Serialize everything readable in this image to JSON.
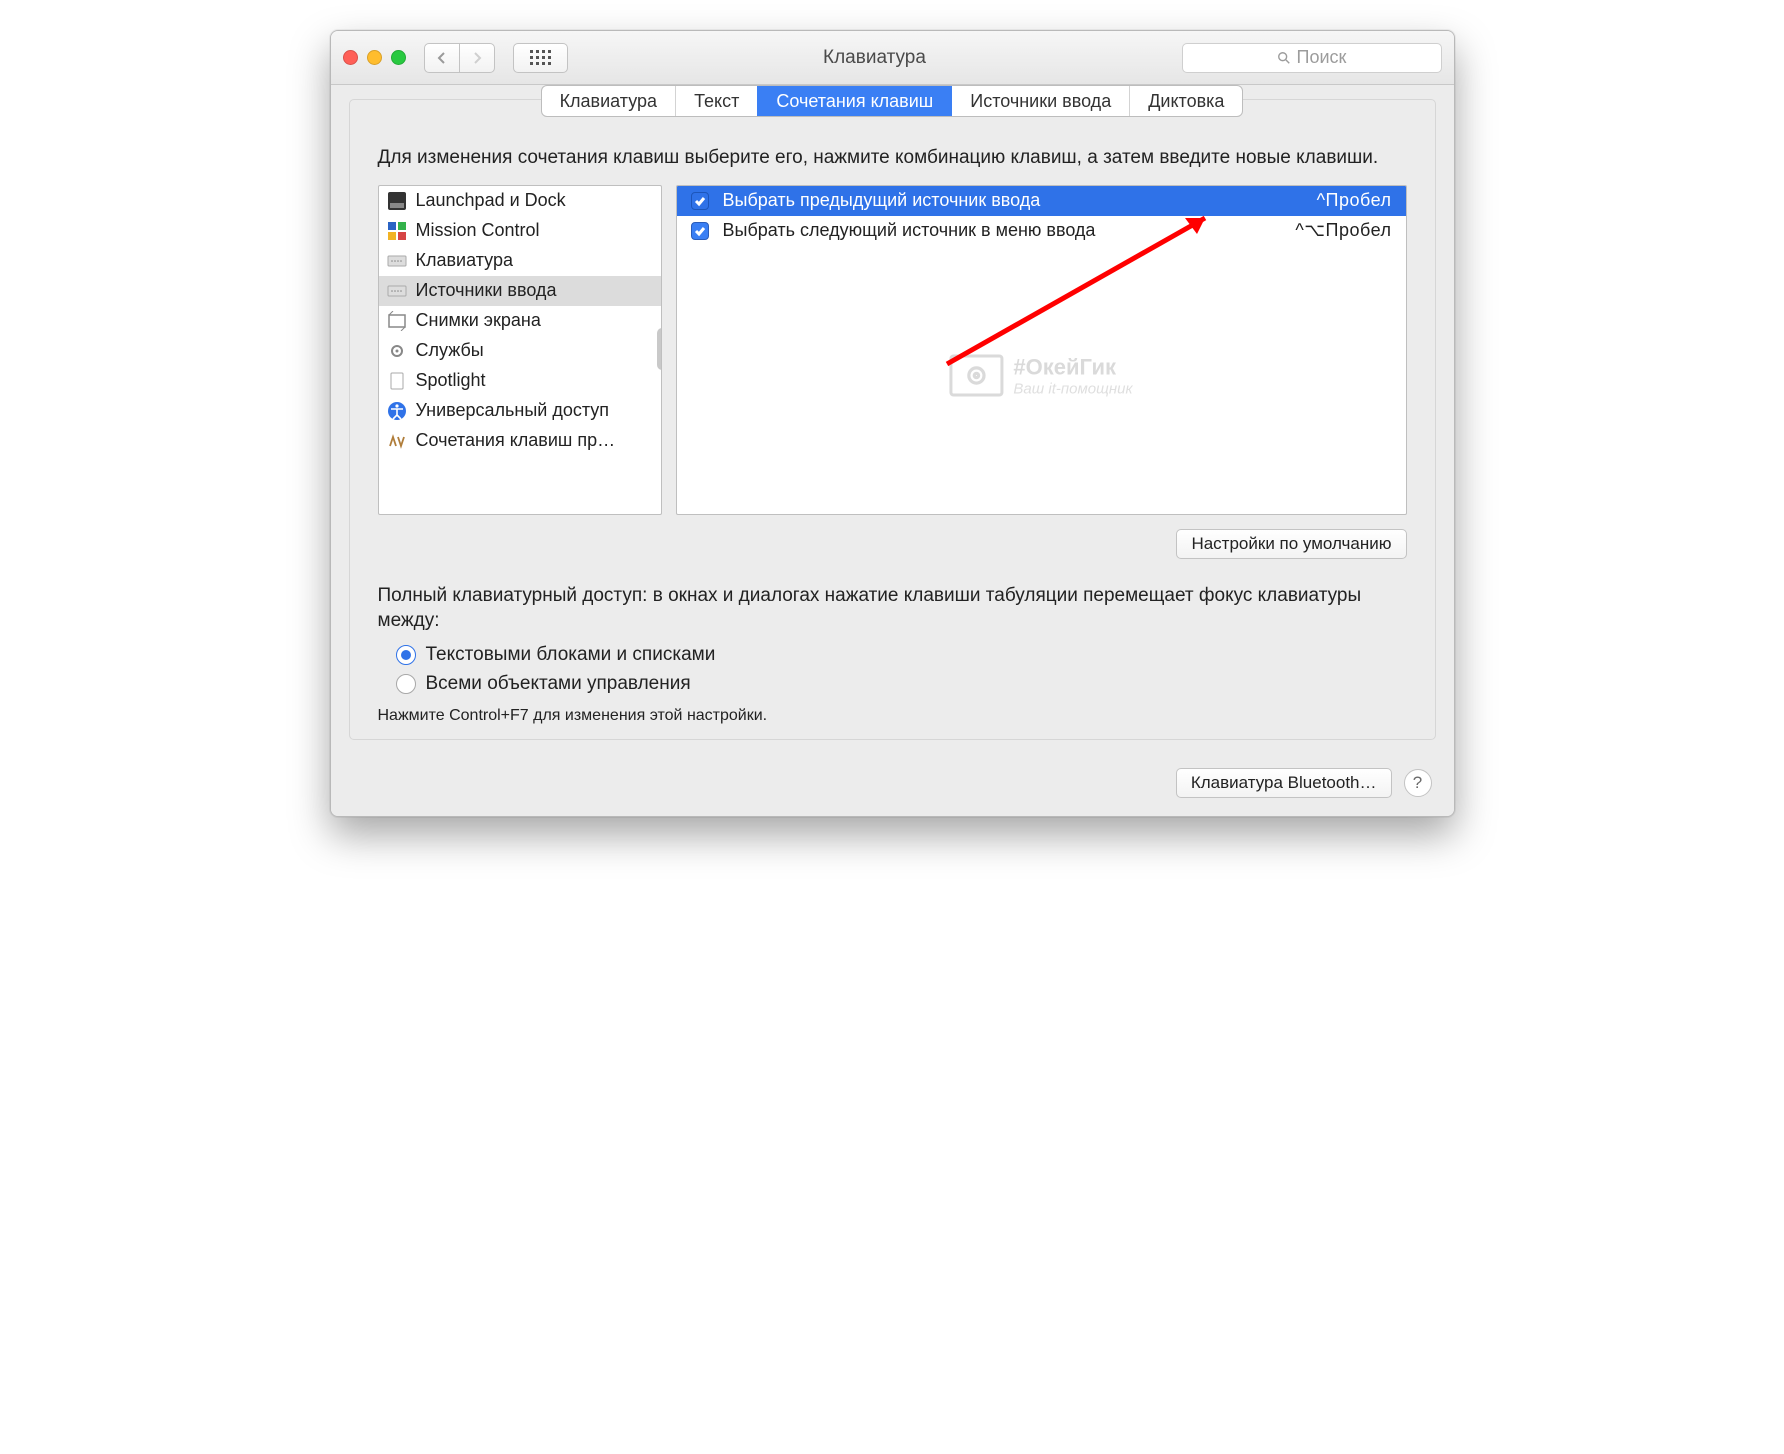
{
  "window": {
    "title": "Клавиатура",
    "search_placeholder": "Поиск"
  },
  "tabs": [
    {
      "label": "Клавиатура",
      "active": false
    },
    {
      "label": "Текст",
      "active": false
    },
    {
      "label": "Сочетания клавиш",
      "active": true
    },
    {
      "label": "Источники ввода",
      "active": false
    },
    {
      "label": "Диктовка",
      "active": false
    }
  ],
  "instruction": "Для изменения сочетания клавиш выберите его, нажмите комбинацию клавиш, а затем введите новые клавиши.",
  "categories": [
    {
      "label": "Launchpad и Dock",
      "icon": "launchpad"
    },
    {
      "label": "Mission Control",
      "icon": "mission"
    },
    {
      "label": "Клавиатура",
      "icon": "keyboard"
    },
    {
      "label": "Источники ввода",
      "icon": "keyboard",
      "selected": true
    },
    {
      "label": "Снимки экрана",
      "icon": "screenshot"
    },
    {
      "label": "Службы",
      "icon": "gear"
    },
    {
      "label": "Spotlight",
      "icon": "doc"
    },
    {
      "label": "Универсальный доступ",
      "icon": "accessibility"
    },
    {
      "label": "Сочетания клавиш пр…",
      "icon": "apps"
    }
  ],
  "shortcuts": [
    {
      "checked": true,
      "label": "Выбрать предыдущий источник ввода",
      "key": "^Пробел",
      "selected": true
    },
    {
      "checked": true,
      "label": "Выбрать следующий источник в меню ввода",
      "key": "^⌥Пробел",
      "selected": false
    }
  ],
  "defaults_button": "Настройки по умолчанию",
  "fullaccess": {
    "text": "Полный клавиатурный доступ: в окнах и диалогах нажатие клавиши табуляции перемещает фокус клавиатуры между:",
    "options": [
      {
        "label": "Текстовыми блоками и списками",
        "selected": true
      },
      {
        "label": "Всеми объектами управления",
        "selected": false
      }
    ],
    "hint": "Нажмите Control+F7 для изменения этой настройки."
  },
  "footer": {
    "bluetooth_button": "Клавиатура Bluetooth…"
  },
  "watermark": {
    "title": "#ОкейГик",
    "subtitle": "Ваш it-помощник"
  }
}
